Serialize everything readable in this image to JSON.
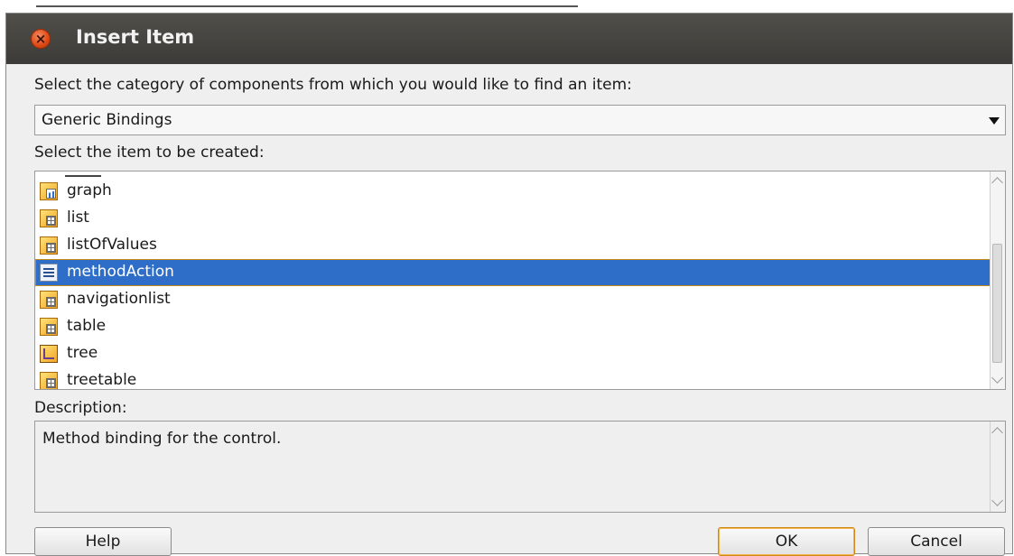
{
  "dialog": {
    "title": "Insert Item",
    "close_icon": "close-icon"
  },
  "category": {
    "label": "Select the category of components from which you would like to find an item:",
    "selected": "Generic Bindings"
  },
  "items": {
    "label": "Select the item to be created:",
    "list": [
      {
        "label": "graph",
        "icon": "graph-icon"
      },
      {
        "label": "list",
        "icon": "list-binding-icon"
      },
      {
        "label": "listOfValues",
        "icon": "list-of-values-icon"
      },
      {
        "label": "methodAction",
        "icon": "method-action-icon",
        "selected": true
      },
      {
        "label": "navigationlist",
        "icon": "navigation-list-icon"
      },
      {
        "label": "table",
        "icon": "table-icon"
      },
      {
        "label": "tree",
        "icon": "tree-icon"
      },
      {
        "label": "treetable",
        "icon": "tree-table-icon"
      }
    ]
  },
  "description": {
    "label": "Description:",
    "text": "Method binding for the control."
  },
  "buttons": {
    "help": "Help",
    "ok": "OK",
    "cancel": "Cancel"
  },
  "colors": {
    "selection": "#2f6ec8",
    "titlebar": "#3c3b37",
    "close_button": "#dd4814",
    "dialog_bg": "#efefef"
  }
}
